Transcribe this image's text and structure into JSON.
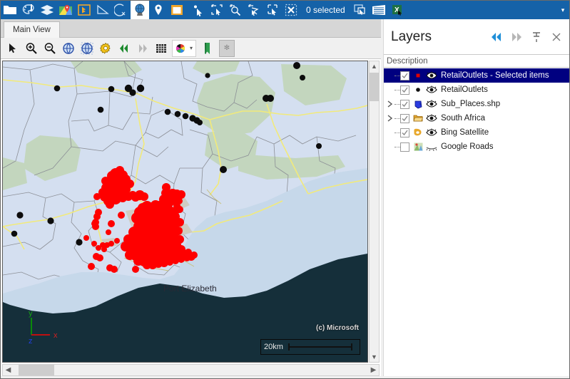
{
  "window": {
    "title": "Main View"
  },
  "ribbon": {
    "selection_status": "0 selected",
    "overflow_label": "▾",
    "buttons": [
      {
        "name": "open-folder-icon",
        "tooltip": "Open Project"
      },
      {
        "name": "palette-settings-icon",
        "tooltip": "Symbology"
      },
      {
        "name": "layers-stack-icon",
        "tooltip": "Layers"
      },
      {
        "name": "map-pin-basemap-icon",
        "tooltip": "Add Basemap"
      },
      {
        "name": "bing-maps-icon",
        "tooltip": "Bing Maps"
      },
      {
        "name": "measure-area-icon",
        "tooltip": "Measure Area"
      },
      {
        "name": "measure-distance-icon",
        "tooltip": "Measure Distance"
      },
      {
        "name": "globe-icon",
        "tooltip": "Globe View"
      },
      {
        "name": "location-marker-icon",
        "tooltip": "Add Point"
      },
      {
        "name": "layout-icon",
        "tooltip": "Layout"
      },
      {
        "name": "select-point-icon",
        "tooltip": "Select by Point"
      },
      {
        "name": "select-rectangle-add-icon",
        "tooltip": "Add to Selection by Rectangle"
      },
      {
        "name": "select-circle-add-icon",
        "tooltip": "Add to Selection by Circle"
      },
      {
        "name": "select-polygon-add-icon",
        "tooltip": "Add to Selection by Polygon"
      },
      {
        "name": "select-rectangle-icon",
        "tooltip": "Select by Rectangle"
      },
      {
        "name": "clear-selection-icon",
        "tooltip": "Clear Selection"
      },
      {
        "name": "zoom-to-selection-icon",
        "tooltip": "Zoom to Selection"
      },
      {
        "name": "attribute-table-icon",
        "tooltip": "Attribute Table"
      },
      {
        "name": "export-excel-icon",
        "tooltip": "Export to Excel"
      }
    ]
  },
  "map_toolbar": {
    "buttons": [
      {
        "name": "pointer-tool",
        "tooltip": "Select"
      },
      {
        "name": "zoom-in-tool",
        "tooltip": "Zoom In"
      },
      {
        "name": "zoom-out-tool",
        "tooltip": "Zoom Out"
      },
      {
        "name": "zoom-to-full-extent-tool",
        "tooltip": "Full Extent"
      },
      {
        "name": "zoom-to-layer-tool",
        "tooltip": "Zoom to Layer"
      },
      {
        "name": "settings-gear-tool",
        "tooltip": "Settings"
      },
      {
        "name": "previous-extent-tool",
        "tooltip": "Previous Extent"
      },
      {
        "name": "next-extent-tool",
        "tooltip": "Next Extent"
      },
      {
        "name": "grid-tool",
        "tooltip": "Grid"
      },
      {
        "name": "color-scheme-tool",
        "tooltip": "Color Scheme"
      },
      {
        "name": "bookmark-tool",
        "tooltip": "Bookmark"
      },
      {
        "name": "snapshot-tool",
        "tooltip": "Snapshot"
      }
    ]
  },
  "map": {
    "place_label": "Port Elizabeth",
    "attribution": "(c) Microsoft",
    "scale_label": "20km",
    "axis": {
      "x": "x",
      "y": "y",
      "z": "z"
    },
    "colors": {
      "land": "#d4dff0",
      "vegetation": "#c3d6be",
      "water_shallow": "#c6d8ea",
      "ocean_dark": "#152f3a",
      "road_major": "#f2ea7a",
      "selected_point": "#fe0000",
      "unselected_point": "#0c0c0c"
    },
    "scrollbars": {
      "vertical_up": "▲",
      "vertical_down": "▼",
      "horizontal_left": "◀",
      "horizontal_right": "▶"
    }
  },
  "layers_panel": {
    "title": "Layers",
    "header_buttons": [
      {
        "name": "collapse-all-button",
        "glyph": "◀◀",
        "state": "active"
      },
      {
        "name": "expand-all-button",
        "glyph": "▶▶",
        "state": "inactive"
      },
      {
        "name": "pin-panel-button",
        "glyph": "pin",
        "state": "inactive"
      },
      {
        "name": "close-panel-button",
        "glyph": "✕",
        "state": "inactive"
      }
    ],
    "column_header": "Description",
    "items": [
      {
        "label": "RetailOutlets - Selected items",
        "checked": true,
        "visible": true,
        "selected": true,
        "expandable": false,
        "symbol": "square",
        "symbol_color": "#e00000"
      },
      {
        "label": "RetailOutlets",
        "checked": true,
        "visible": true,
        "selected": false,
        "expandable": false,
        "symbol": "circle",
        "symbol_color": "#111111"
      },
      {
        "label": "Sub_Places.shp",
        "checked": true,
        "visible": true,
        "selected": false,
        "expandable": true,
        "symbol": "polygon",
        "symbol_color": "#2b3ce0"
      },
      {
        "label": "South Africa",
        "checked": true,
        "visible": true,
        "selected": false,
        "expandable": true,
        "symbol": "folder",
        "symbol_color": "#e8a82c"
      },
      {
        "label": "Bing Satellite",
        "checked": true,
        "visible": true,
        "selected": false,
        "expandable": false,
        "symbol": "bing",
        "symbol_color": "#e8a82c"
      },
      {
        "label": "Google Roads",
        "checked": false,
        "visible": false,
        "selected": false,
        "expandable": false,
        "symbol": "google",
        "symbol_color": "#4a9b4a"
      }
    ]
  }
}
